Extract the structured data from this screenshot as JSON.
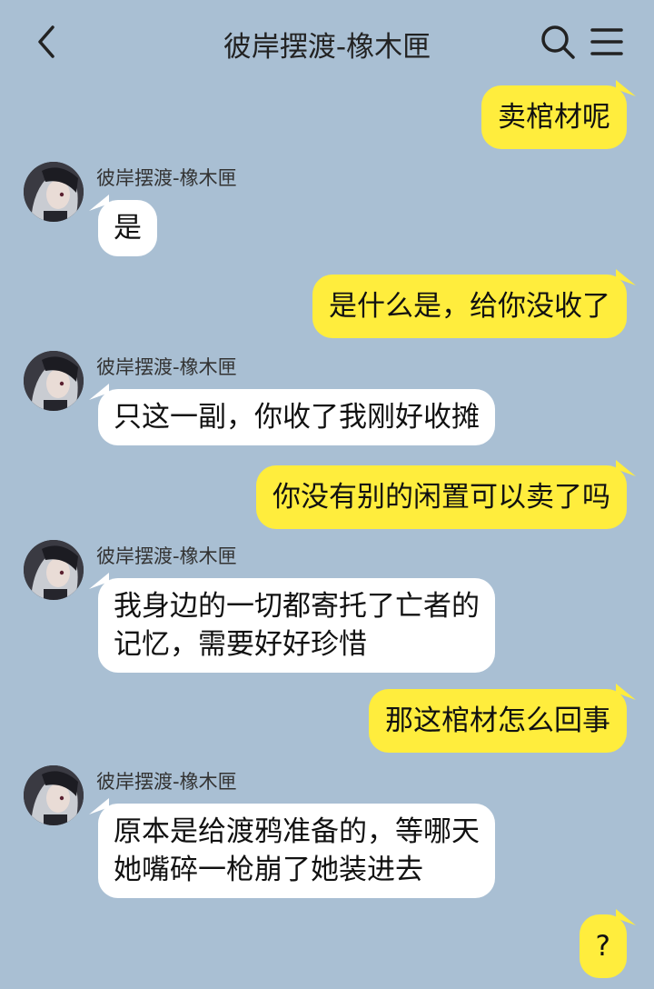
{
  "header": {
    "title": "彼岸摆渡-橡木匣",
    "back_icon": "chevron-left-icon",
    "search_icon": "search-icon",
    "menu_icon": "menu-icon"
  },
  "colors": {
    "background": "#a9bfd3",
    "outgoing_bubble": "#ffed3d",
    "incoming_bubble": "#ffffff"
  },
  "messages": [
    {
      "side": "right",
      "text": "卖棺材呢"
    },
    {
      "side": "left",
      "sender": "彼岸摆渡-橡木匣",
      "text": "是"
    },
    {
      "side": "right",
      "text": "是什么是，给你没收了"
    },
    {
      "side": "left",
      "sender": "彼岸摆渡-橡木匣",
      "text": "只这一副，你收了我刚好收摊"
    },
    {
      "side": "right",
      "text": "你没有别的闲置可以卖了吗"
    },
    {
      "side": "left",
      "sender": "彼岸摆渡-橡木匣",
      "lines": [
        "我身边的一切都寄托了亡者的",
        "记忆，需要好好珍惜"
      ]
    },
    {
      "side": "right",
      "text": "那这棺材怎么回事"
    },
    {
      "side": "left",
      "sender": "彼岸摆渡-橡木匣",
      "lines": [
        "原本是给渡鸦准备的，等哪天",
        "她嘴碎一枪崩了她装进去"
      ]
    },
    {
      "side": "right",
      "text": "?"
    }
  ]
}
